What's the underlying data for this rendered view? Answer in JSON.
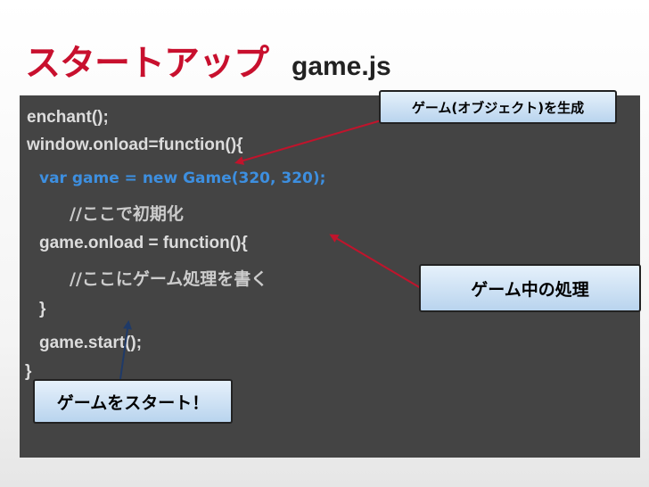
{
  "title": {
    "main": "スタートアップ",
    "file": "game.js"
  },
  "code": {
    "line1": "enchant();",
    "line2": "window.onload=function(){",
    "line3": "var game = new Game(320, 320);",
    "line4": "//ここで初期化",
    "line5": "game.onload = function(){",
    "line6": "//ここにゲーム処理を書く",
    "line7": "}",
    "line8": "game.start();",
    "line9": "}"
  },
  "callouts": {
    "create": "ゲーム(オブジェクト)を生成",
    "process": "ゲーム中の処理",
    "start": "ゲームをスタート！"
  },
  "colors": {
    "title": "#c8102e",
    "panel": "#444444",
    "highlight": "#3d8fe0",
    "arrow_red": "#c0142c",
    "arrow_navy": "#1f3a68"
  }
}
